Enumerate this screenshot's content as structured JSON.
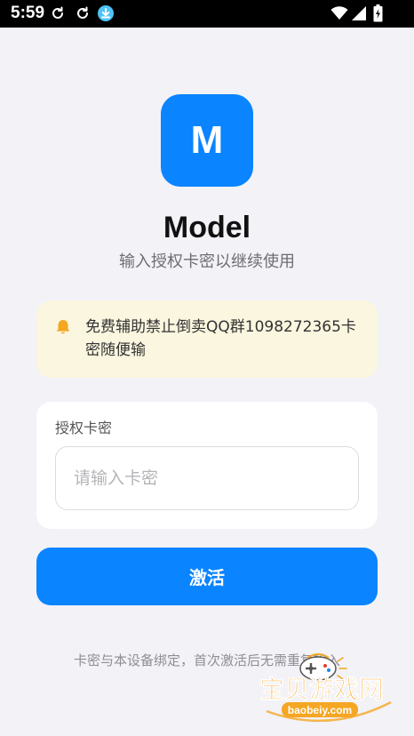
{
  "status_bar": {
    "time": "5:59",
    "icons": [
      "refresh-icon",
      "refresh-icon",
      "download-icon",
      "wifi-icon",
      "signal-icon",
      "battery-charging-icon"
    ]
  },
  "logo": {
    "letter": "M",
    "color": "#0a84ff"
  },
  "app": {
    "title": "Model",
    "subtitle": "输入授权卡密以继续使用"
  },
  "notice": {
    "icon": "bell-icon",
    "text": "免费辅助禁止倒卖QQ群1098272365卡密随便输",
    "background": "#fbf6df",
    "icon_color": "#f5a623"
  },
  "form": {
    "label": "授权卡密",
    "placeholder": "请输入卡密",
    "value": ""
  },
  "activate_button": {
    "label": "激活",
    "color": "#0a84ff"
  },
  "footer": {
    "note": "卡密与本设备绑定，首次激活后无需重复输入"
  },
  "watermark": {
    "text": "宝贝游戏网",
    "url_text": "baobeiy.com"
  }
}
